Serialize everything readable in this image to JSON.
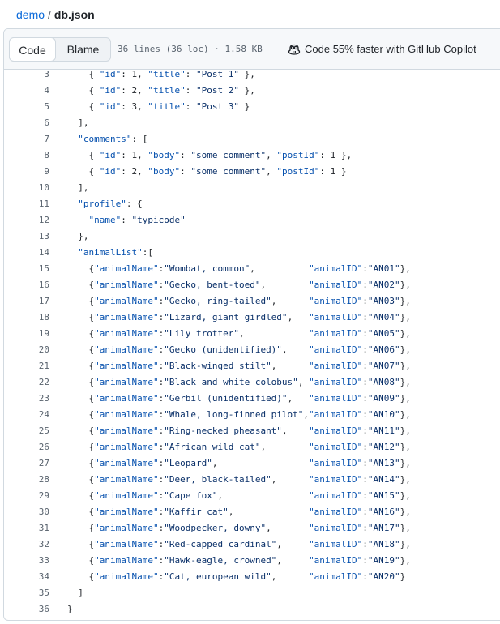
{
  "breadcrumb": {
    "repo": "demo",
    "separator": "/",
    "file": "db.json"
  },
  "toolbar": {
    "code_label": "Code",
    "blame_label": "Blame",
    "meta": "36 lines (36 loc) · 1.58 KB",
    "copilot_label": "Code 55% faster with GitHub Copilot",
    "copilot_icon": "copilot-icon"
  },
  "colors": {
    "key": "#0550ae",
    "string": "#0a3069",
    "line_number": "#59636e",
    "link": "#0969da"
  },
  "lines": [
    {
      "n": "3",
      "text": "    { \"id\": 1, \"title\": \"Post 1\" },"
    },
    {
      "n": "4",
      "text": "    { \"id\": 2, \"title\": \"Post 2\" },"
    },
    {
      "n": "5",
      "text": "    { \"id\": 3, \"title\": \"Post 3\" }"
    },
    {
      "n": "6",
      "text": "  ],"
    },
    {
      "n": "7",
      "text": "  \"comments\": ["
    },
    {
      "n": "8",
      "text": "    { \"id\": 1, \"body\": \"some comment\", \"postId\": 1 },"
    },
    {
      "n": "9",
      "text": "    { \"id\": 2, \"body\": \"some comment\", \"postId\": 1 }"
    },
    {
      "n": "10",
      "text": "  ],"
    },
    {
      "n": "11",
      "text": "  \"profile\": {"
    },
    {
      "n": "12",
      "text": "    \"name\": \"typicode\""
    },
    {
      "n": "13",
      "text": "  },"
    },
    {
      "n": "14",
      "text": "  \"animalList\":["
    },
    {
      "n": "15",
      "text": "    {\"animalName\":\"Wombat, common\",          \"animalID\":\"AN01\"},"
    },
    {
      "n": "16",
      "text": "    {\"animalName\":\"Gecko, bent-toed\",        \"animalID\":\"AN02\"},"
    },
    {
      "n": "17",
      "text": "    {\"animalName\":\"Gecko, ring-tailed\",      \"animalID\":\"AN03\"},"
    },
    {
      "n": "18",
      "text": "    {\"animalName\":\"Lizard, giant girdled\",   \"animalID\":\"AN04\"},"
    },
    {
      "n": "19",
      "text": "    {\"animalName\":\"Lily trotter\",            \"animalID\":\"AN05\"},"
    },
    {
      "n": "20",
      "text": "    {\"animalName\":\"Gecko (unidentified)\",    \"animalID\":\"AN06\"},"
    },
    {
      "n": "21",
      "text": "    {\"animalName\":\"Black-winged stilt\",      \"animalID\":\"AN07\"},"
    },
    {
      "n": "22",
      "text": "    {\"animalName\":\"Black and white colobus\", \"animalID\":\"AN08\"},"
    },
    {
      "n": "23",
      "text": "    {\"animalName\":\"Gerbil (unidentified)\",   \"animalID\":\"AN09\"},"
    },
    {
      "n": "24",
      "text": "    {\"animalName\":\"Whale, long-finned pilot\",\"animalID\":\"AN10\"},"
    },
    {
      "n": "25",
      "text": "    {\"animalName\":\"Ring-necked pheasant\",    \"animalID\":\"AN11\"},"
    },
    {
      "n": "26",
      "text": "    {\"animalName\":\"African wild cat\",        \"animalID\":\"AN12\"},"
    },
    {
      "n": "27",
      "text": "    {\"animalName\":\"Leopard\",                 \"animalID\":\"AN13\"},"
    },
    {
      "n": "28",
      "text": "    {\"animalName\":\"Deer, black-tailed\",      \"animalID\":\"AN14\"},"
    },
    {
      "n": "29",
      "text": "    {\"animalName\":\"Cape fox\",                \"animalID\":\"AN15\"},"
    },
    {
      "n": "30",
      "text": "    {\"animalName\":\"Kaffir cat\",              \"animalID\":\"AN16\"},"
    },
    {
      "n": "31",
      "text": "    {\"animalName\":\"Woodpecker, downy\",       \"animalID\":\"AN17\"},"
    },
    {
      "n": "32",
      "text": "    {\"animalName\":\"Red-capped cardinal\",     \"animalID\":\"AN18\"},"
    },
    {
      "n": "33",
      "text": "    {\"animalName\":\"Hawk-eagle, crowned\",     \"animalID\":\"AN19\"},"
    },
    {
      "n": "34",
      "text": "    {\"animalName\":\"Cat, european wild\",      \"animalID\":\"AN20\"}"
    },
    {
      "n": "35",
      "text": "  ]"
    },
    {
      "n": "36",
      "text": "}"
    }
  ]
}
